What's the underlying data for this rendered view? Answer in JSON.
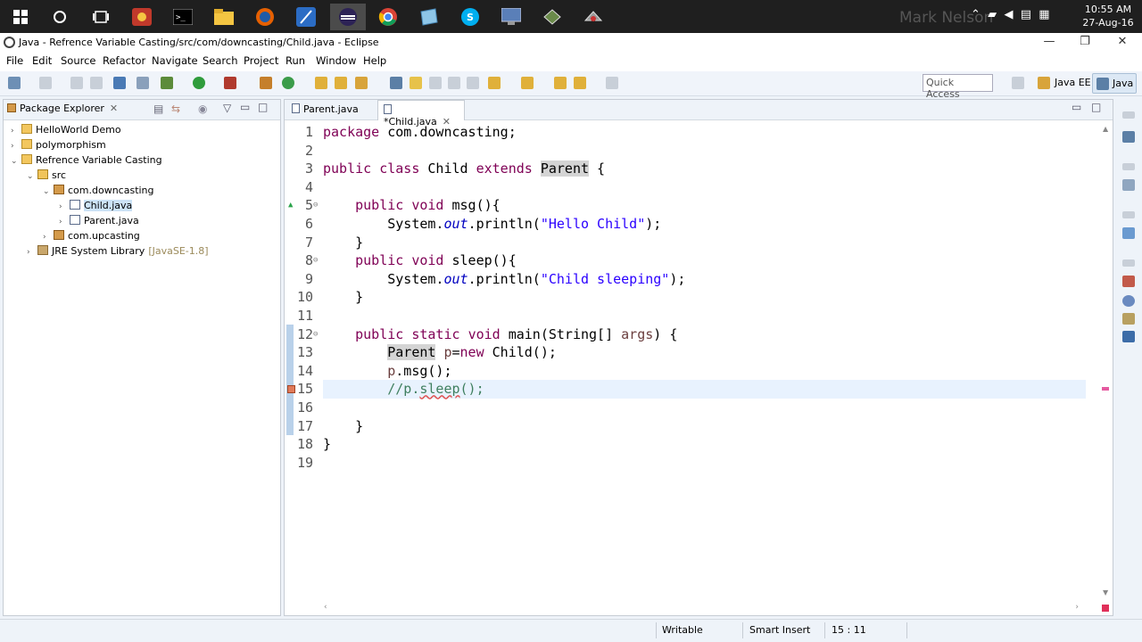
{
  "taskbar": {
    "overlay_name": "Mark Nelson",
    "time": "10:55 AM",
    "date": "27-Aug-16",
    "icons": [
      "windows-start-icon",
      "search-circle-icon",
      "task-view-icon",
      "app-red-icon",
      "terminal-icon",
      "file-explorer-icon",
      "firefox-icon",
      "app-feather-icon",
      "eclipse-icon",
      "chrome-icon",
      "notepad-icon",
      "skype-icon",
      "network-tool-icon",
      "bitlocker-icon",
      "tool-icon"
    ]
  },
  "window": {
    "title": "Java - Refrence Variable Casting/src/com/downcasting/Child.java - Eclipse",
    "minimize": "—",
    "restore": "❐",
    "close": "✕"
  },
  "menu": [
    "File",
    "Edit",
    "Source",
    "Refactor",
    "Navigate",
    "Search",
    "Project",
    "Run",
    "Window",
    "Help"
  ],
  "toolbar": {
    "quick_access": "Quick Access",
    "perspective_javaee": "Java EE",
    "perspective_java": "Java"
  },
  "package_explorer": {
    "tab_label": "Package Explorer",
    "close": "✕",
    "tree": [
      {
        "label": "HelloWorld Demo",
        "depth": 0,
        "arrow": "›",
        "icon": "project-icon"
      },
      {
        "label": "polymorphism",
        "depth": 0,
        "arrow": "›",
        "icon": "project-icon"
      },
      {
        "label": "Refrence Variable Casting",
        "depth": 0,
        "arrow": "⌄",
        "icon": "project-icon"
      },
      {
        "label": "src",
        "depth": 1,
        "arrow": "⌄",
        "icon": "source-folder-icon"
      },
      {
        "label": "com.downcasting",
        "depth": 2,
        "arrow": "⌄",
        "icon": "package-icon"
      },
      {
        "label": "Child.java",
        "depth": 3,
        "arrow": "›",
        "icon": "java-file-icon",
        "selected": true
      },
      {
        "label": "Parent.java",
        "depth": 3,
        "arrow": "›",
        "icon": "java-file-icon"
      },
      {
        "label": "com.upcasting",
        "depth": 2,
        "arrow": "›",
        "icon": "package-icon"
      },
      {
        "label": "JRE System Library",
        "depth": 1,
        "arrow": "›",
        "icon": "library-icon",
        "decoration": "[JavaSE-1.8]"
      }
    ]
  },
  "editor": {
    "tabs": [
      {
        "label": "Parent.java",
        "active": false
      },
      {
        "label": "*Child.java",
        "active": true,
        "close": "✕"
      }
    ],
    "line_numbers": [
      "1",
      "2",
      "3",
      "4",
      "5",
      "6",
      "7",
      "8",
      "9",
      "10",
      "11",
      "12",
      "13",
      "14",
      "15",
      "16",
      "17",
      "18",
      "19"
    ]
  },
  "status": {
    "writable": "Writable",
    "insert_mode": "Smart Insert",
    "position": "15 : 11"
  }
}
